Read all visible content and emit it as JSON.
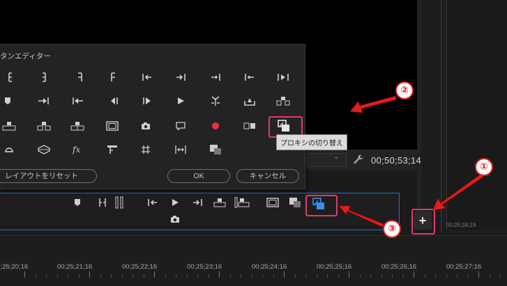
{
  "dialog": {
    "title": "タンエディター",
    "reset_label": "レイアウトをリセット",
    "ok_label": "OK",
    "cancel_label": "キャンセル",
    "tooltip": "プロキシの切り替え"
  },
  "monitor": {
    "timecode": "00;50;53;14",
    "right_panel_time": "00;25;34;19"
  },
  "plus_label": "+",
  "markers": {
    "one": "①",
    "two": "②",
    "three": "③"
  },
  "ruler": {
    "labels": [
      "00;25;20;16",
      "00;25;21;16",
      "00;25;22;16",
      "00;25;23;16",
      "00;25;24;16",
      "00;25;25;16",
      "00;25;26;16",
      "00;25;27;16"
    ]
  },
  "dialog_buttons": [
    "mark-in",
    "mark-out",
    "mark-clip",
    "add-marker",
    "go-to-in",
    "go-to-out",
    "go-to-next-edit",
    "go-to-previous-edit",
    "play-in-to-out",
    "marker",
    "step-forward",
    "step-back",
    "step-back-frame",
    "play-stop",
    "play",
    "trim-monitor",
    "export-frame",
    "lift",
    "extract",
    "insert",
    "overwrite",
    "safe-margins",
    "camera",
    "comparison-view",
    "record",
    "multi-camera",
    "proxy-toggle",
    "loop",
    "vr-video",
    "fx",
    "lumetri",
    "grid",
    "fit",
    "overlay"
  ],
  "bar_buttons": [
    "marker",
    "mark-in-out",
    "mark-clip",
    "go-to-in",
    "play",
    "go-to-out",
    "insert",
    "overwrite",
    "safe-margins",
    "comparison-view",
    "proxy-toggle",
    "camera"
  ],
  "colors": {
    "accent": "#2f6fd0",
    "highlight": "#e23a6a",
    "record": "#e8343b"
  }
}
